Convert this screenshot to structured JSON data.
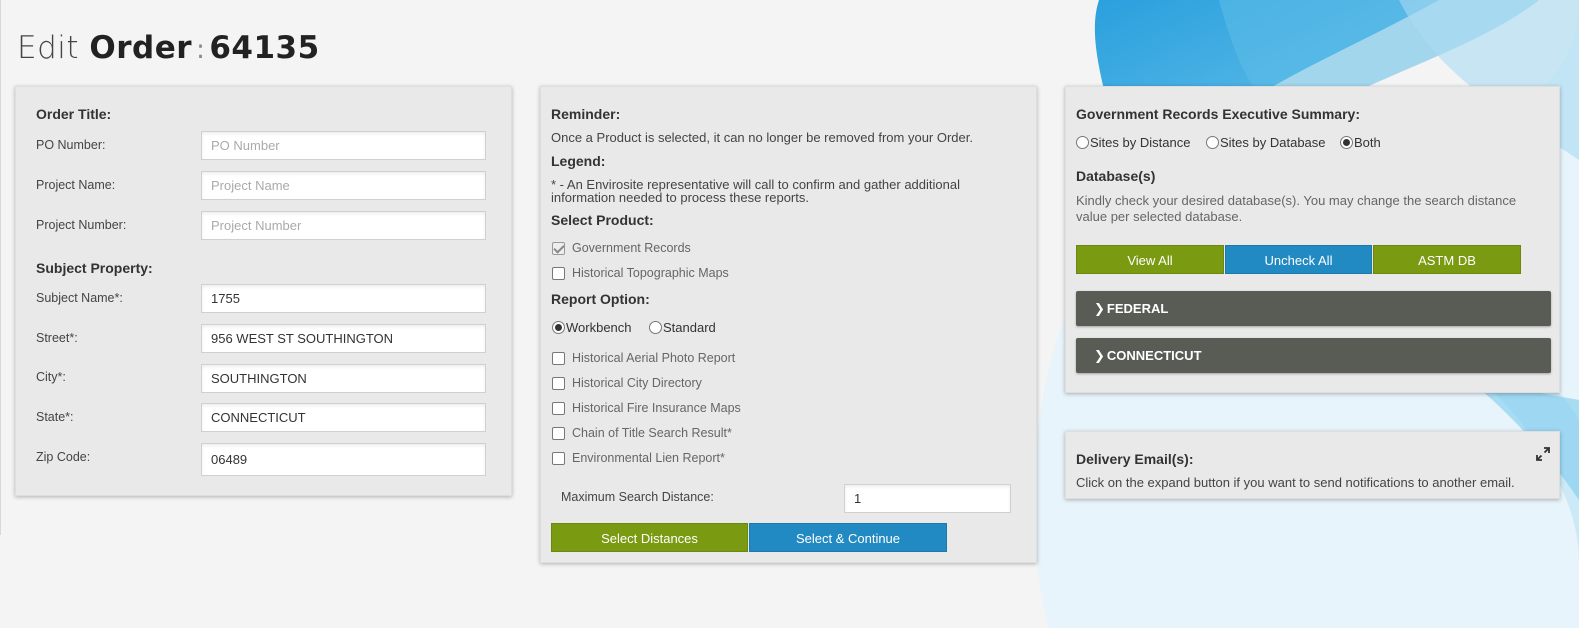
{
  "page_title": {
    "edit": "Edit",
    "order": "Order",
    "separator": ":",
    "number": "64135"
  },
  "order_panel": {
    "order_title_heading": "Order Title:",
    "po_number": {
      "label": "PO Number:",
      "placeholder": "PO Number",
      "value": ""
    },
    "project_name": {
      "label": "Project Name:",
      "placeholder": "Project Name",
      "value": ""
    },
    "project_number": {
      "label": "Project Number:",
      "placeholder": "Project Number",
      "value": ""
    },
    "subject_property_heading": "Subject Property:",
    "subject_name": {
      "label": "Subject Name*:",
      "value": "1755"
    },
    "street": {
      "label": "Street*:",
      "value": "956 WEST ST SOUTHINGTON"
    },
    "city": {
      "label": "City*:",
      "value": "SOUTHINGTON"
    },
    "state": {
      "label": "State*:",
      "value": "CONNECTICUT"
    },
    "zip_code": {
      "label": "Zip Code:",
      "value": "06489"
    }
  },
  "product_panel": {
    "reminder_heading": "Reminder:",
    "reminder_text": "Once a Product is selected, it can no longer be removed from your Order.",
    "legend_heading": "Legend:",
    "legend_line1": "* - An Envirosite representative will call to confirm and gather additional",
    "legend_line2": "information needed to process these reports.",
    "select_product_heading": "Select Product:",
    "products": [
      {
        "label": "Government Records",
        "checked": true
      },
      {
        "label": "Historical Topographic Maps",
        "checked": false
      }
    ],
    "report_option_heading": "Report Option:",
    "report_options": [
      {
        "label": "Workbench",
        "selected": true
      },
      {
        "label": "Standard",
        "selected": false
      }
    ],
    "reports": [
      {
        "label": "Historical Aerial Photo Report",
        "checked": false
      },
      {
        "label": "Historical City Directory",
        "checked": false
      },
      {
        "label": "Historical Fire Insurance Maps",
        "checked": false
      },
      {
        "label": "Chain of Title Search Result*",
        "checked": false
      },
      {
        "label": "Environmental Lien Report*",
        "checked": false
      }
    ],
    "max_distance": {
      "label": "Maximum Search Distance:",
      "value": "1"
    },
    "select_distances_label": "Select Distances",
    "select_continue_label": "Select & Continue"
  },
  "gov_panel": {
    "heading": "Government Records Executive Summary:",
    "summary_options": [
      {
        "label": "Sites by Distance",
        "selected": false
      },
      {
        "label": "Sites by Database",
        "selected": false
      },
      {
        "label": "Both",
        "selected": true
      }
    ],
    "databases_heading": "Database(s)",
    "databases_line1": "Kindly check your desired database(s). You may change the search distance",
    "databases_line2": "value per selected database.",
    "view_all_label": "View All",
    "uncheck_all_label": "Uncheck All",
    "astm_db_label": "ASTM DB",
    "sections": [
      {
        "label": "FEDERAL"
      },
      {
        "label": "CONNECTICUT"
      }
    ]
  },
  "delivery_panel": {
    "heading": "Delivery Email(s):",
    "text": "Click on the expand button if you want to send notifications to another email."
  },
  "colors": {
    "green": "#7a9a12",
    "blue": "#228ac2",
    "accordion": "#595c55",
    "panel": "#e9e9e9"
  }
}
